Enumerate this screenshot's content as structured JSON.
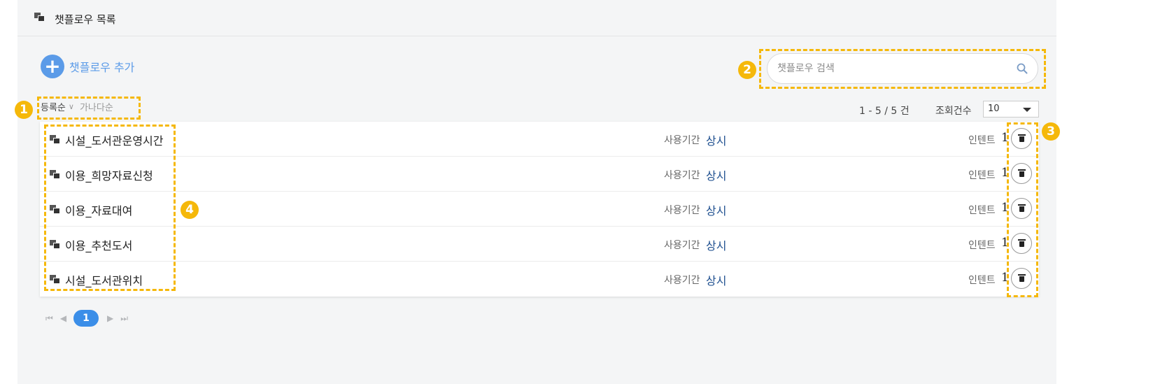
{
  "header": {
    "title": "챗플로우 목록",
    "icon": "chatflow-icon"
  },
  "toolbar": {
    "add_label": "챗플로우 추가",
    "add_icon": "+"
  },
  "search": {
    "placeholder": "챗플로우 검색"
  },
  "sort": {
    "registered": "등록순",
    "caret": "∨",
    "alphabetical": "가나다순"
  },
  "list_info": {
    "count": "1 - 5 / 5 건",
    "per_page_label": "조회건수",
    "per_page_value": "10"
  },
  "rows": [
    {
      "name": "시설_도서관운영시간",
      "period_label": "사용기간",
      "period_value": "상시",
      "intent_label": "인텐트",
      "intent_count": "1"
    },
    {
      "name": "이용_희망자료신청",
      "period_label": "사용기간",
      "period_value": "상시",
      "intent_label": "인텐트",
      "intent_count": "1"
    },
    {
      "name": "이용_자료대여",
      "period_label": "사용기간",
      "period_value": "상시",
      "intent_label": "인텐트",
      "intent_count": "1"
    },
    {
      "name": "이용_추천도서",
      "period_label": "사용기간",
      "period_value": "상시",
      "intent_label": "인텐트",
      "intent_count": "1"
    },
    {
      "name": "시설_도서관위치",
      "period_label": "사용기간",
      "period_value": "상시",
      "intent_label": "인텐트",
      "intent_count": "1"
    }
  ],
  "pagination": {
    "first": "⏮",
    "prev": "◀",
    "current": "1",
    "next": "▶",
    "last": "⏭"
  },
  "annotations": [
    "1",
    "2",
    "3",
    "4"
  ],
  "colors": {
    "accent": "#5b9be8",
    "highlight": "#f5b80a",
    "link": "#1e4f8f",
    "page_active": "#3b8ee8"
  }
}
